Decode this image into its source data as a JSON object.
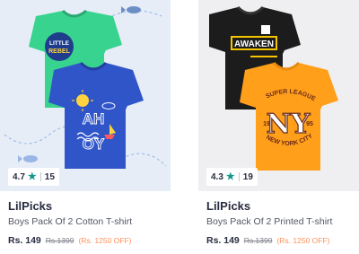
{
  "products": [
    {
      "brand": "LilPicks",
      "title": "Boys Pack Of 2 Cotton T-shirt",
      "rating": "4.7",
      "rating_count": "15",
      "price": "Rs. 149",
      "mrp": "Rs.1399",
      "discount": "(Rs. 1250 OFF)",
      "shirt_front_color": "#2f55c9",
      "shirt_back_color": "#37d38f",
      "print_text_back": "LITTLE REBEL",
      "print_text_front": "AHOY"
    },
    {
      "brand": "LilPicks",
      "title": "Boys Pack Of 2 Printed T-shirt",
      "rating": "4.3",
      "rating_count": "19",
      "price": "Rs. 149",
      "mrp": "Rs.1399",
      "discount": "(Rs. 1250 OFF)",
      "shirt_front_color": "#ff9f1a",
      "shirt_back_color": "#1c1c1c",
      "print_text_back": "AWAKEN",
      "print_text_front": "NY",
      "print_text_front_top": "SUPER LEAGUE",
      "print_text_front_bottom": "NEW YORK CITY",
      "print_text_front_left": "19",
      "print_text_front_right": "95"
    }
  ],
  "colors": {
    "accent_star": "#14958f",
    "discount": "#ff905a"
  }
}
